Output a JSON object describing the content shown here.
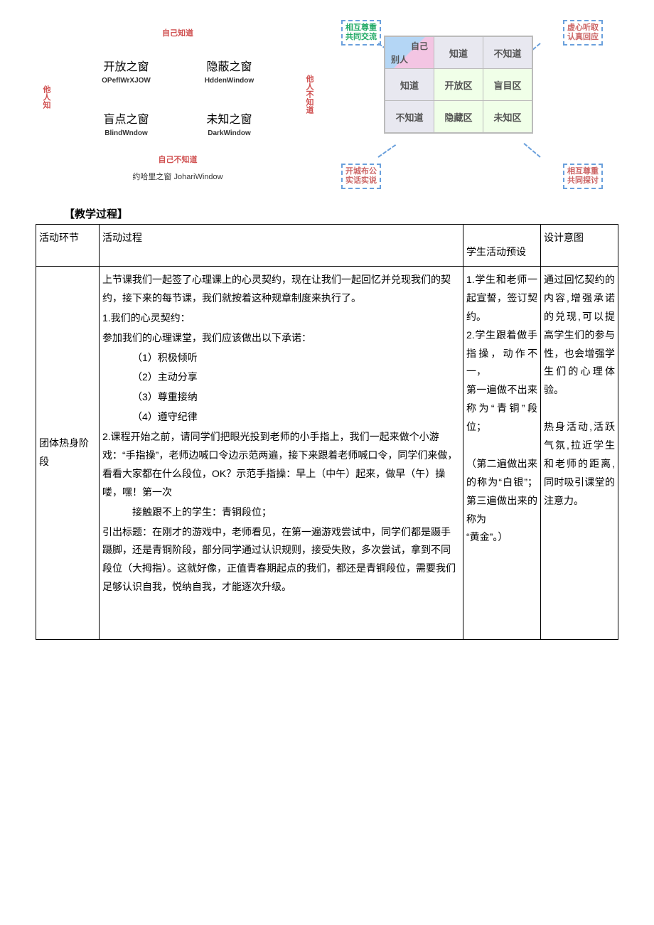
{
  "johari_left": {
    "top": "自己知道",
    "bottom": "自己不知道",
    "left": "他人知",
    "right": "他人不知道",
    "cells": [
      {
        "cn": "开放之窗",
        "en": "OPeflWrXJOW"
      },
      {
        "cn": "隐蔽之窗",
        "en": "HddenWindow"
      },
      {
        "cn": "盲点之窗",
        "en": "BlindWndow"
      },
      {
        "cn": "未知之窗",
        "en": "DarkWindow"
      }
    ],
    "caption": "约哈里之窗 JohariWindow"
  },
  "johari_right": {
    "tl_l1": "相互尊重",
    "tl_l2": "共同交流",
    "tr_l1": "虚心听取",
    "tr_l2": "认真回应",
    "bl_l1": "开城布公",
    "bl_l2": "实话实说",
    "br_l1": "相互尊重",
    "br_l2": "共同探讨",
    "corner_a": "自己",
    "corner_b": "别人",
    "col_know": "知道",
    "col_unknow": "不知道",
    "row_know": "知道",
    "row_unknow": "不知道",
    "z_open": "开放区",
    "z_blind": "盲目区",
    "z_hidden": "隐藏区",
    "z_unknown": "未知区"
  },
  "section_title": "【教学过程】",
  "headers": {
    "c1": "活动环节",
    "c2": "活动过程",
    "c3": "学生活动预设",
    "c4": "设计意图"
  },
  "row1": {
    "stage": "团体热身阶段",
    "process": {
      "p0": "上节课我们一起签了心理课上的心灵契约，现在让我们一起回忆并兑现我们的契约，接下来的每节课，我们就按着这种规章制度来执行了。",
      "p1": "1.我们的心灵契约：",
      "p1a": "参加我们的心理课堂，我们应该做出以下承诺：",
      "li1": "（1）积极倾听",
      "li2": "（2）主动分享",
      "li3": "（3）尊重接纳",
      "li4": "（4）遵守纪律",
      "p2": "2.课程开始之前，请同学们把眼光投到老师的小手指上，我们一起来做个小游戏：“手指操”，老师边喊口令边示范两遍，接下来跟着老师喊口令，同学们来做，看看大家都在什么段位，OK？示范手指操：早上（中午）起来，做早（午）操喽，嘿！第一次",
      "p2a": "接触跟不上的学生：青铜段位；",
      "p3": "引出标题：在刚才的游戏中，老师看见，在第一遍游戏尝试中，同学们都是蹑手蹑脚，还是青铜阶段，部分同学通过认识规则，接受失败，多次尝试，拿到不同段位（大拇指）。这就好像，正值青春期起点的我们，都还是青铜段位，需要我们足够认识自我，悦纳自我，才能逐次升级。"
    },
    "student": "1.学生和老师一起宣誓，签订契约。\n2.学生跟着做手指操，动作不一，\n第一遍做不出来称为“青铜”段位；\n\n（第二遍做出来的称为“白银”；第三遍做出来的称为\n“黄金”。）",
    "intent": "通过回忆契约的内容,增强承诺的兑现,可以提高学生们的参与性，也会增强学生们的心理体验。\n\n热身活动,活跃气氛,拉近学生和老师的距离,同时吸引课堂的注意力。"
  }
}
